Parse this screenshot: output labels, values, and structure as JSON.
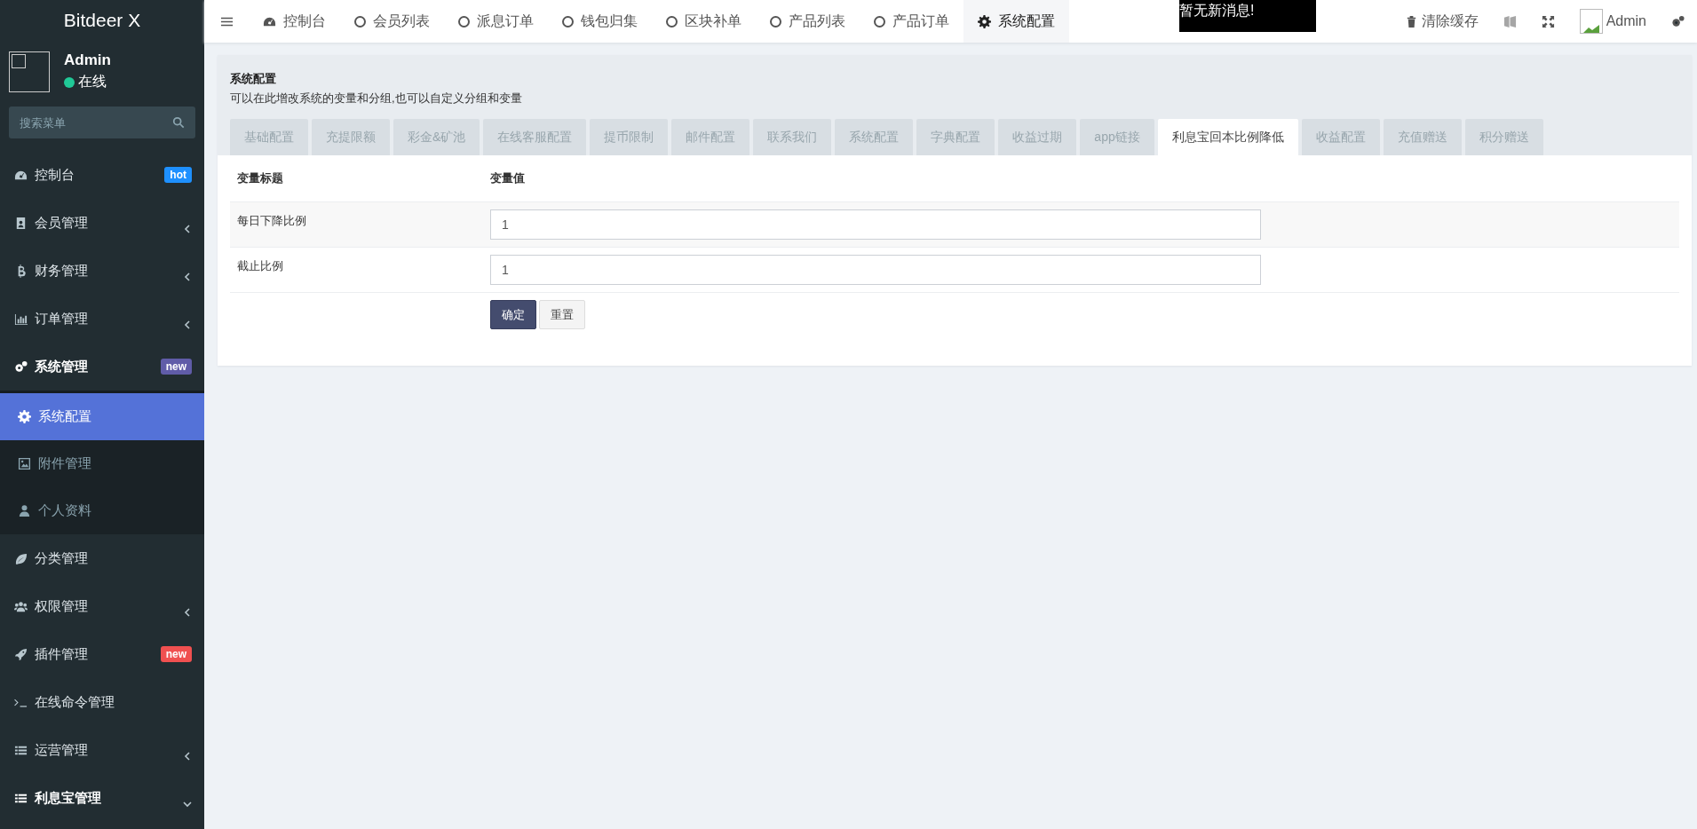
{
  "brand": "Bitdeer X",
  "user": {
    "name": "Admin",
    "status": "在线"
  },
  "search": {
    "placeholder": "搜索菜单"
  },
  "sidebar": {
    "items": [
      {
        "label": "控制台",
        "badge": "hot",
        "color": "#1e90ff"
      },
      {
        "label": "会员管理",
        "expanded": false
      },
      {
        "label": "财务管理",
        "expanded": false
      },
      {
        "label": "订单管理",
        "expanded": false
      },
      {
        "label": "系统管理",
        "badge": "new",
        "color": "#605ca8",
        "expanded": true,
        "children": [
          {
            "label": "系统配置",
            "selected": true
          },
          {
            "label": "附件管理",
            "selected": false
          },
          {
            "label": "个人资料",
            "selected": false
          }
        ]
      },
      {
        "label": "分类管理"
      },
      {
        "label": "权限管理",
        "expanded": false
      },
      {
        "label": "插件管理",
        "badge": "new",
        "color": "#f05050"
      },
      {
        "label": "在线命令管理"
      },
      {
        "label": "运营管理",
        "expanded": false
      },
      {
        "label": "利息宝管理",
        "expanded": true
      }
    ]
  },
  "top_tabs": [
    {
      "label": "控制台",
      "selected": false
    },
    {
      "label": "会员列表",
      "selected": false
    },
    {
      "label": "派息订单",
      "selected": false
    },
    {
      "label": "钱包归集",
      "selected": false
    },
    {
      "label": "区块补单",
      "selected": false
    },
    {
      "label": "产品列表",
      "selected": false
    },
    {
      "label": "产品订单",
      "selected": false
    },
    {
      "label": "系统配置",
      "selected": true
    }
  ],
  "notification": "暂无新消息!",
  "top_actions": {
    "clear_cache": "清除缓存",
    "admin": "Admin"
  },
  "panel": {
    "title": "系统配置",
    "subtitle": "可以在此增改系统的变量和分组,也可以自定义分组和变量",
    "tabs": [
      {
        "label": "基础配置",
        "selected": false
      },
      {
        "label": "充提限额",
        "selected": false
      },
      {
        "label": "彩金&矿池",
        "selected": false
      },
      {
        "label": "在线客服配置",
        "selected": false
      },
      {
        "label": "提币限制",
        "selected": false
      },
      {
        "label": "邮件配置",
        "selected": false
      },
      {
        "label": "联系我们",
        "selected": false
      },
      {
        "label": "系统配置",
        "selected": false
      },
      {
        "label": "字典配置",
        "selected": false
      },
      {
        "label": "收益过期",
        "selected": false
      },
      {
        "label": "app链接",
        "selected": false
      },
      {
        "label": "利息宝回本比例降低",
        "selected": true
      },
      {
        "label": "收益配置",
        "selected": false
      },
      {
        "label": "充值赠送",
        "selected": false
      },
      {
        "label": "积分赠送",
        "selected": false
      }
    ],
    "columns": [
      "变量标题",
      "变量值"
    ],
    "rows": [
      {
        "title": "每日下降比例",
        "value": "1"
      },
      {
        "title": "截止比例",
        "value": "1"
      }
    ],
    "buttons": {
      "submit": "确定",
      "reset": "重置"
    }
  }
}
